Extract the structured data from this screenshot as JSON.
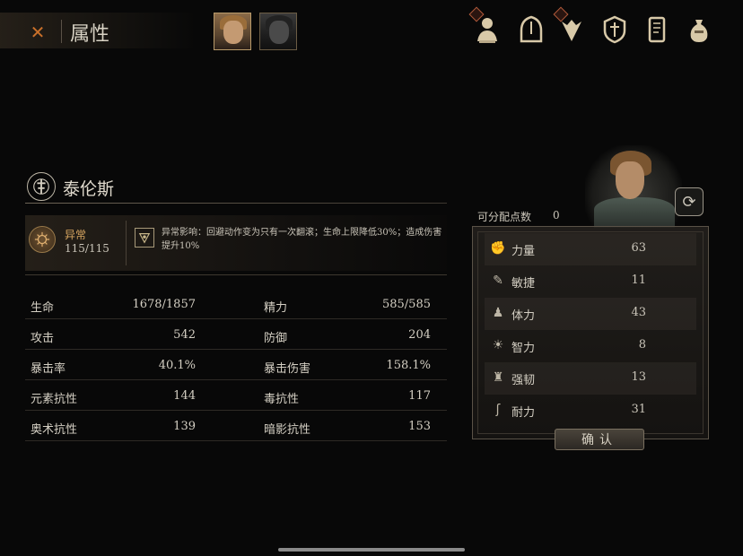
{
  "header": {
    "title": "属性",
    "close_icon": "close-icon"
  },
  "party": [
    {
      "name": "portrait-tarens",
      "icon": "male-portrait"
    },
    {
      "name": "portrait-companion",
      "icon": "female-portrait"
    }
  ],
  "top_icons": [
    "bust-icon",
    "helmet-icon",
    "sigil-icon",
    "shield-icon",
    "book-icon",
    "pouch-icon"
  ],
  "character": {
    "name": "泰伦斯"
  },
  "status": {
    "label": "异常",
    "value": "115/115",
    "effect": "异常影响：回避动作变为只有一次翻滚；生命上限降低30%；造成伤害提升10%"
  },
  "stats": [
    {
      "left_label": "生命",
      "left_value": "1678/1857",
      "right_label": "精力",
      "right_value": "585/585"
    },
    {
      "left_label": "攻击",
      "left_value": "542",
      "right_label": "防御",
      "right_value": "204"
    },
    {
      "left_label": "暴击率",
      "left_value": "40.1%",
      "right_label": "暴击伤害",
      "right_value": "158.1%"
    },
    {
      "left_label": "元素抗性",
      "left_value": "144",
      "right_label": "毒抗性",
      "right_value": "117"
    },
    {
      "left_label": "奥术抗性",
      "left_value": "139",
      "right_label": "暗影抗性",
      "right_value": "153"
    }
  ],
  "allocation": {
    "label": "可分配点数",
    "value": "0",
    "attributes": [
      {
        "name": "力量",
        "value": "63",
        "icon": "fist-icon"
      },
      {
        "name": "敏捷",
        "value": "11",
        "icon": "feather-icon"
      },
      {
        "name": "体力",
        "value": "43",
        "icon": "body-icon"
      },
      {
        "name": "智力",
        "value": "8",
        "icon": "mind-icon"
      },
      {
        "name": "强韧",
        "value": "13",
        "icon": "armor-icon"
      },
      {
        "name": "耐力",
        "value": "31",
        "icon": "leg-icon"
      }
    ],
    "confirm_label": "确认"
  }
}
